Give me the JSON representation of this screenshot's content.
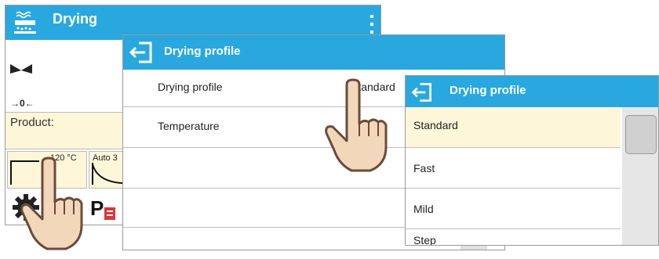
{
  "main_screen": {
    "title": "Drying",
    "menu_icon": "kebab-menu-icon",
    "app_icon": "drying-app-icon",
    "stable_icon": "stability-marker-icon",
    "zero_marker": "→0←",
    "product_label": "Product:",
    "profile_tile": {
      "temperature": "120 °C"
    },
    "auto_tile": {
      "label": "Auto 3"
    }
  },
  "profile_panel": {
    "title": "Drying profile",
    "back_icon": "exit-back-icon",
    "rows": [
      {
        "label": "Drying profile",
        "value": "Standard"
      },
      {
        "label": "Temperature",
        "value": ""
      },
      {
        "label": "",
        "value": ""
      },
      {
        "label": "",
        "value": ""
      }
    ]
  },
  "options_panel": {
    "title": "Drying profile",
    "back_icon": "exit-back-icon",
    "options": [
      "Standard",
      "Fast",
      "Mild",
      "Step"
    ]
  },
  "colors": {
    "header": "#29a8e0",
    "product_bar": "#fdf6d8",
    "selected_row": "#fdf6d8"
  }
}
